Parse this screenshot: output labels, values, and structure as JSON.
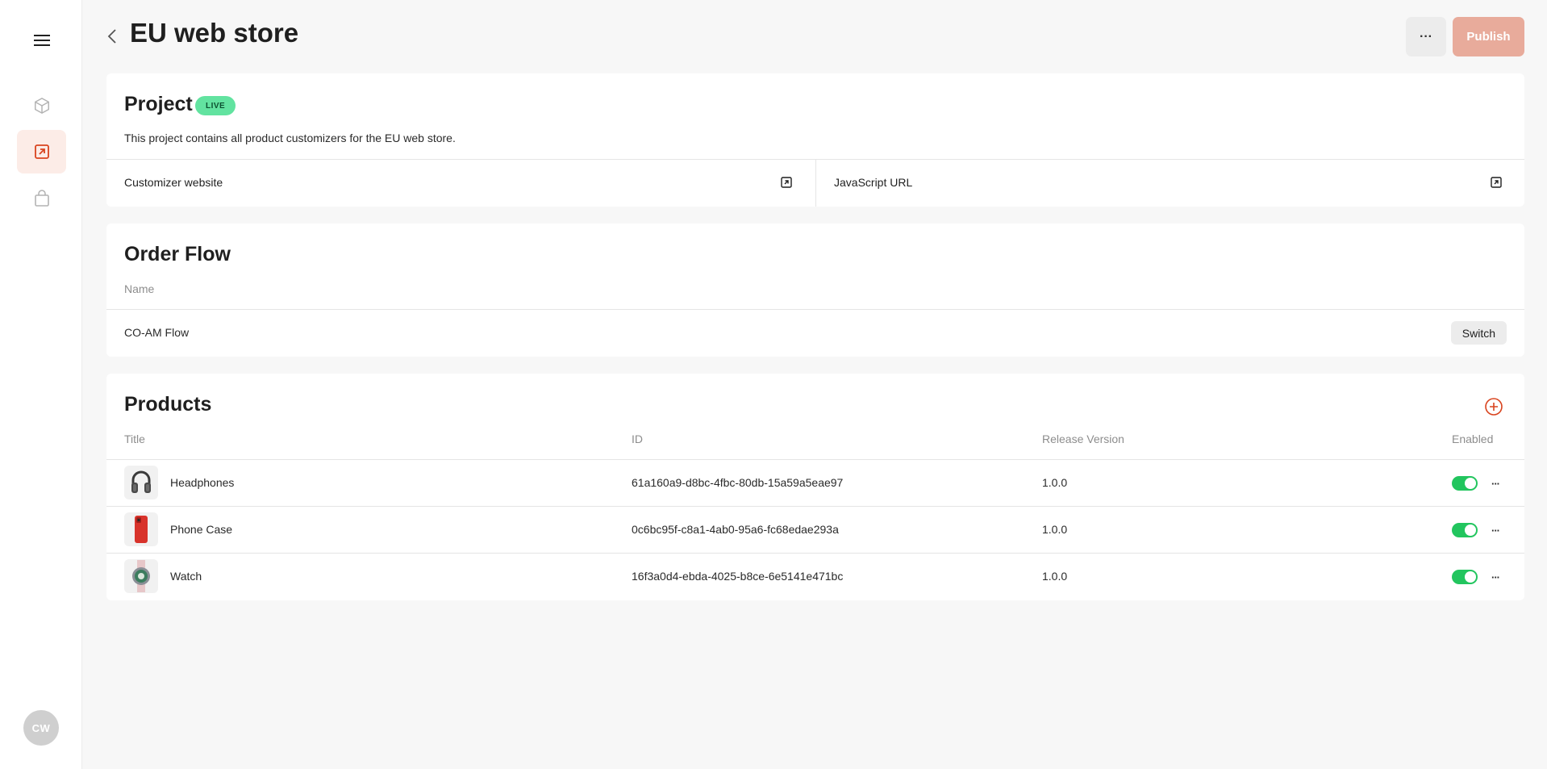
{
  "sidebar": {
    "items": [
      {
        "name": "menu",
        "icon": "hamburger-icon"
      },
      {
        "name": "products",
        "icon": "cube-icon"
      },
      {
        "name": "projects",
        "icon": "external-link-icon",
        "active": true
      },
      {
        "name": "orders",
        "icon": "shopping-bag-icon"
      }
    ],
    "avatar_initials": "CW"
  },
  "header": {
    "title": "EU web store",
    "more_label": "···",
    "publish_label": "Publish"
  },
  "project": {
    "heading": "Project",
    "badge": "LIVE",
    "description": "This project contains all product customizers for the EU web store.",
    "links": [
      {
        "label": "Customizer website"
      },
      {
        "label": "JavaScript URL"
      }
    ]
  },
  "order_flow": {
    "heading": "Order Flow",
    "column_name": "Name",
    "flow_name": "CO-AM Flow",
    "switch_label": "Switch"
  },
  "products": {
    "heading": "Products",
    "columns": {
      "title": "Title",
      "id": "ID",
      "release": "Release Version",
      "enabled": "Enabled"
    },
    "rows": [
      {
        "title": "Headphones",
        "id": "61a160a9-d8bc-4fbc-80db-15a59a5eae97",
        "release": "1.0.0",
        "enabled": true,
        "more": "···"
      },
      {
        "title": "Phone Case",
        "id": "0c6bc95f-c8a1-4ab0-95a6-fc68edae293a",
        "release": "1.0.0",
        "enabled": true,
        "more": "···"
      },
      {
        "title": "Watch",
        "id": "16f3a0d4-ebda-4025-b8ce-6e5141e471bc",
        "release": "1.0.0",
        "enabled": true,
        "more": "···"
      }
    ]
  },
  "colors": {
    "accent": "#d9441f",
    "publish": "#e8ab9b",
    "live_badge": "#62e3a0",
    "toggle_on": "#22c55e"
  }
}
